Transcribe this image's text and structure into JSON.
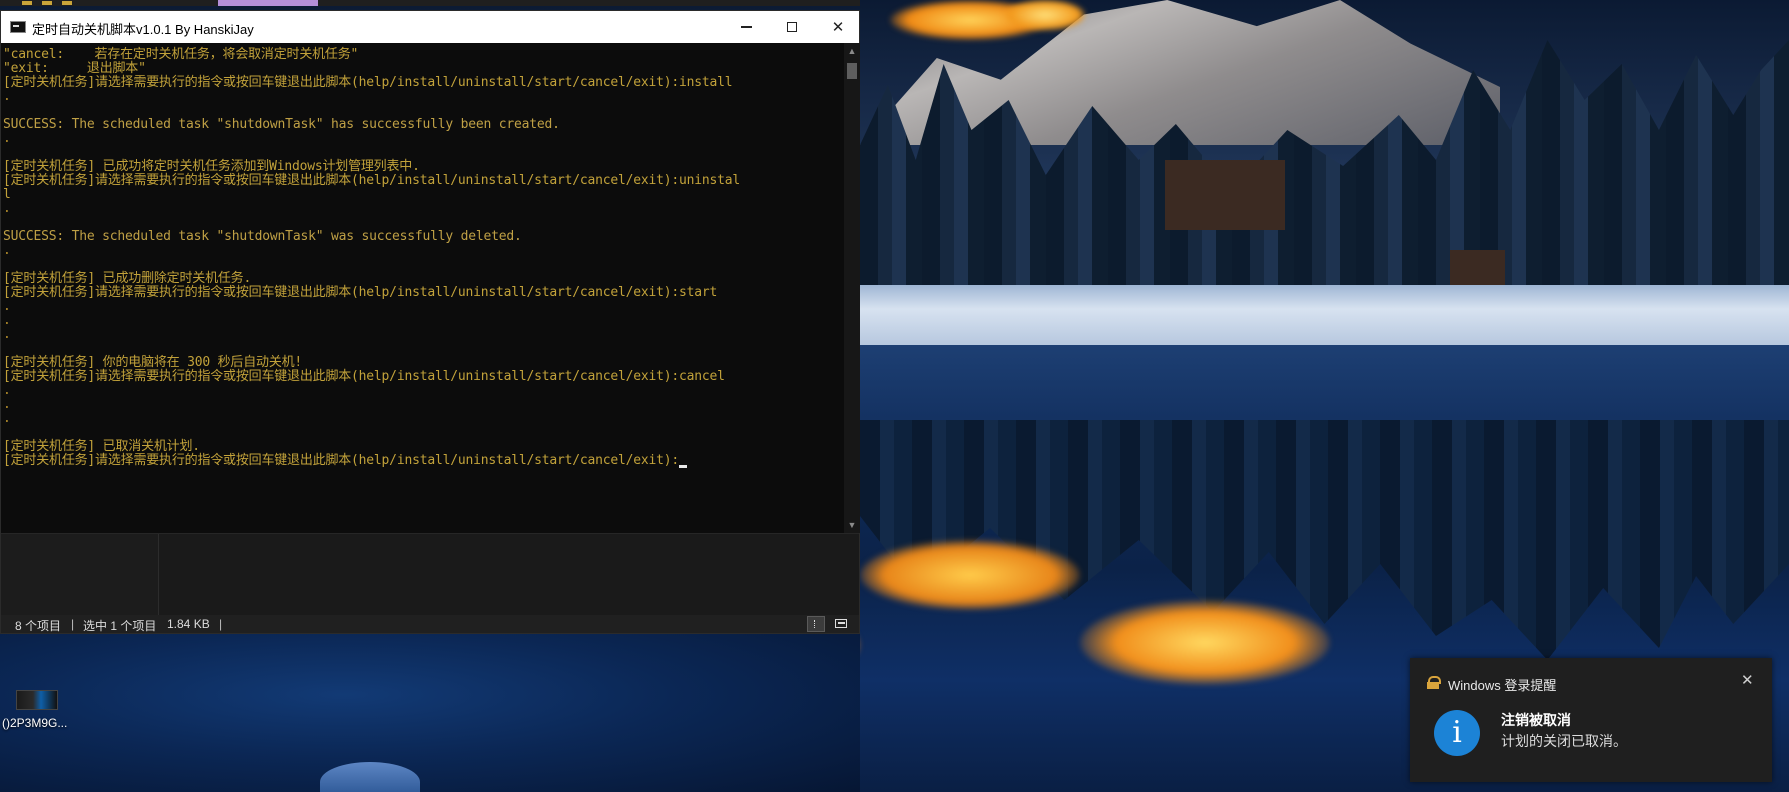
{
  "window": {
    "title": "定时自动关机脚本v1.0.1 By HanskiJay"
  },
  "console": {
    "lines": [
      "\"cancel:    若存在定时关机任务，将会取消定时关机任务\"",
      "\"exit:     退出脚本\"",
      "[定时关机任务]请选择需要执行的指令或按回车键退出此脚本(help/install/uninstall/start/cancel/exit):install",
      ".",
      "",
      "SUCCESS: The scheduled task \"shutdownTask\" has successfully been created.",
      ".",
      "",
      "[定时关机任务] 已成功将定时关机任务添加到Windows计划管理列表中.",
      "[定时关机任务]请选择需要执行的指令或按回车键退出此脚本(help/install/uninstall/start/cancel/exit):uninstal",
      "l",
      ".",
      "",
      "SUCCESS: The scheduled task \"shutdownTask\" was successfully deleted.",
      ".",
      "",
      "[定时关机任务] 已成功删除定时关机任务.",
      "[定时关机任务]请选择需要执行的指令或按回车键退出此脚本(help/install/uninstall/start/cancel/exit):start",
      ".",
      ".",
      ".",
      "",
      "[定时关机任务] 你的电脑将在 300 秒后自动关机!",
      "[定时关机任务]请选择需要执行的指令或按回车键退出此脚本(help/install/uninstall/start/cancel/exit):cancel",
      ".",
      ".",
      ".",
      "",
      "[定时关机任务] 已取消关机计划.",
      "[定时关机任务]请选择需要执行的指令或按回车键退出此脚本(help/install/uninstall/start/cancel/exit):"
    ]
  },
  "statusbar": {
    "items_count": "8 个项目",
    "selected": "选中 1 个项目",
    "size": "1.84 KB"
  },
  "desktop": {
    "icon_label": "()2P3M9G..."
  },
  "toast": {
    "app_name": "Windows 登录提醒",
    "heading": "注销被取消",
    "body": "计划的关闭已取消。"
  },
  "colors": {
    "console_text": "#c2a23a",
    "info_icon": "#1c83d6"
  }
}
